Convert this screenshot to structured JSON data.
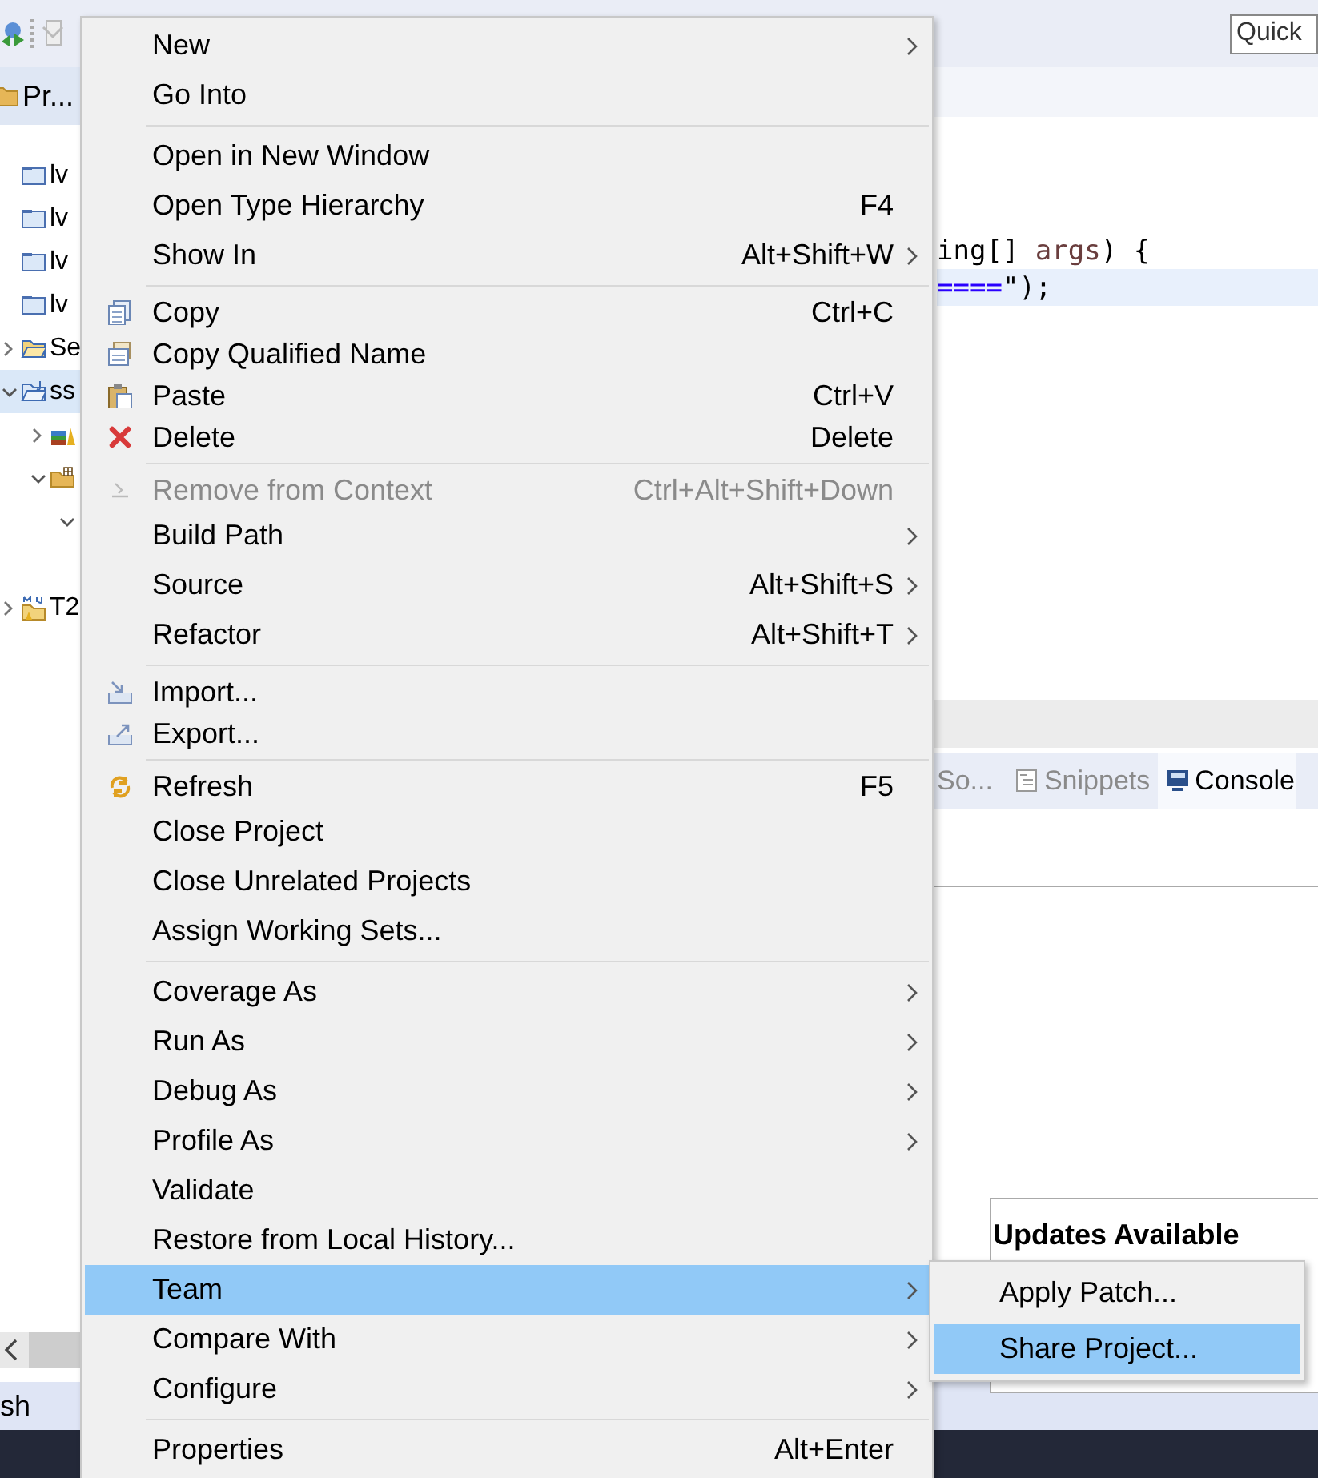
{
  "toolbar": {
    "quick_access": {
      "placeholder": "Quick"
    }
  },
  "project_explorer": {
    "tab": {
      "label": "Pr..."
    },
    "items": [
      {
        "label": "lv",
        "kind": "project",
        "selected": false
      },
      {
        "label": "lv",
        "kind": "project",
        "selected": false
      },
      {
        "label": "lv",
        "kind": "project",
        "selected": false
      },
      {
        "label": "lv",
        "kind": "project",
        "selected": false
      },
      {
        "label": "Se",
        "kind": "folder",
        "expandable": true,
        "expanded": false,
        "selected": false
      },
      {
        "label": "ss",
        "kind": "java_project",
        "expandable": true,
        "expanded": true,
        "selected": true,
        "children": [
          {
            "kind": "library",
            "expandable": true,
            "expanded": false,
            "selected": false
          },
          {
            "kind": "package",
            "expandable": true,
            "expanded": true,
            "selected": false,
            "children": [
              {
                "expandable": true,
                "expanded": true,
                "selected": false
              }
            ]
          }
        ]
      },
      {
        "label": "T2",
        "kind": "maven_project",
        "expandable": true,
        "expanded": false,
        "selected": false
      }
    ]
  },
  "editor": {
    "lines": [
      {
        "highlighted": false,
        "tokens": [
          {
            "text": "ing[] ",
            "kind": "plain"
          },
          {
            "text": "args",
            "kind": "variable"
          },
          {
            "text": ") {",
            "kind": "plain"
          }
        ]
      },
      {
        "highlighted": true,
        "tokens": [
          {
            "text": "====",
            "kind": "string"
          },
          {
            "text": "\");",
            "kind": "plain"
          }
        ]
      }
    ]
  },
  "views": {
    "tabs": [
      {
        "label": "So...",
        "kind": "plain",
        "selected": false
      },
      {
        "label": "Snippets",
        "kind": "snippets",
        "selected": false
      },
      {
        "label": "Console",
        "kind": "console",
        "selected": true
      }
    ]
  },
  "status_bar": {
    "text": "sh"
  },
  "context_menu": {
    "items": [
      {
        "kind": "item",
        "label": "New",
        "submenu": true,
        "disabled": false,
        "selected": false
      },
      {
        "kind": "item",
        "label": "Go Into",
        "disabled": false,
        "selected": false
      },
      {
        "kind": "separator"
      },
      {
        "kind": "item",
        "label": "Open in New Window",
        "disabled": false,
        "selected": false
      },
      {
        "kind": "item",
        "label": "Open Type Hierarchy",
        "shortcut": "F4",
        "disabled": false,
        "selected": false
      },
      {
        "kind": "item",
        "label": "Show In",
        "shortcut": "Alt+Shift+W",
        "submenu": true,
        "disabled": false,
        "selected": false
      },
      {
        "kind": "separator"
      },
      {
        "kind": "copy",
        "label": "Copy",
        "shortcut": "Ctrl+C",
        "disabled": false,
        "selected": false
      },
      {
        "kind": "copy_name",
        "label": "Copy Qualified Name",
        "disabled": false,
        "selected": false
      },
      {
        "kind": "paste",
        "label": "Paste",
        "shortcut": "Ctrl+V",
        "disabled": false,
        "selected": false
      },
      {
        "kind": "delete",
        "label": "Delete",
        "shortcut": "Delete",
        "disabled": false,
        "selected": false
      },
      {
        "kind": "separator"
      },
      {
        "kind": "remove",
        "label": "Remove from Context",
        "shortcut": "Ctrl+Alt+Shift+Down",
        "disabled": true,
        "selected": false
      },
      {
        "kind": "item",
        "label": "Build Path",
        "submenu": true,
        "disabled": false,
        "selected": false
      },
      {
        "kind": "item",
        "label": "Source",
        "shortcut": "Alt+Shift+S",
        "submenu": true,
        "disabled": false,
        "selected": false
      },
      {
        "kind": "item",
        "label": "Refactor",
        "shortcut": "Alt+Shift+T",
        "submenu": true,
        "disabled": false,
        "selected": false
      },
      {
        "kind": "separator"
      },
      {
        "kind": "import",
        "label": "Import...",
        "disabled": false,
        "selected": false
      },
      {
        "kind": "export",
        "label": "Export...",
        "disabled": false,
        "selected": false
      },
      {
        "kind": "separator"
      },
      {
        "kind": "refresh",
        "label": "Refresh",
        "shortcut": "F5",
        "disabled": false,
        "selected": false
      },
      {
        "kind": "item",
        "label": "Close Project",
        "disabled": false,
        "selected": false
      },
      {
        "kind": "item",
        "label": "Close Unrelated Projects",
        "disabled": false,
        "selected": false
      },
      {
        "kind": "item",
        "label": "Assign Working Sets...",
        "disabled": false,
        "selected": false
      },
      {
        "kind": "separator"
      },
      {
        "kind": "item",
        "label": "Coverage As",
        "submenu": true,
        "disabled": false,
        "selected": false
      },
      {
        "kind": "item",
        "label": "Run As",
        "submenu": true,
        "disabled": false,
        "selected": false
      },
      {
        "kind": "item",
        "label": "Debug As",
        "submenu": true,
        "disabled": false,
        "selected": false
      },
      {
        "kind": "item",
        "label": "Profile As",
        "submenu": true,
        "disabled": false,
        "selected": false
      },
      {
        "kind": "item",
        "label": "Validate",
        "disabled": false,
        "selected": false
      },
      {
        "kind": "item",
        "label": "Restore from Local History...",
        "disabled": false,
        "selected": false
      },
      {
        "kind": "item",
        "label": "Team",
        "submenu": true,
        "disabled": false,
        "selected": true
      },
      {
        "kind": "item",
        "label": "Compare With",
        "submenu": true,
        "disabled": false,
        "selected": false
      },
      {
        "kind": "item",
        "label": "Configure",
        "submenu": true,
        "disabled": false,
        "selected": false
      },
      {
        "kind": "separator"
      },
      {
        "kind": "item",
        "label": "Properties",
        "shortcut": "Alt+Enter",
        "disabled": false,
        "selected": false
      }
    ]
  },
  "team_submenu": {
    "items": [
      {
        "label": "Apply Patch...",
        "selected": false
      },
      {
        "label": "Share Project...",
        "selected": true
      }
    ]
  },
  "notification": {
    "title": "Updates Available"
  }
}
